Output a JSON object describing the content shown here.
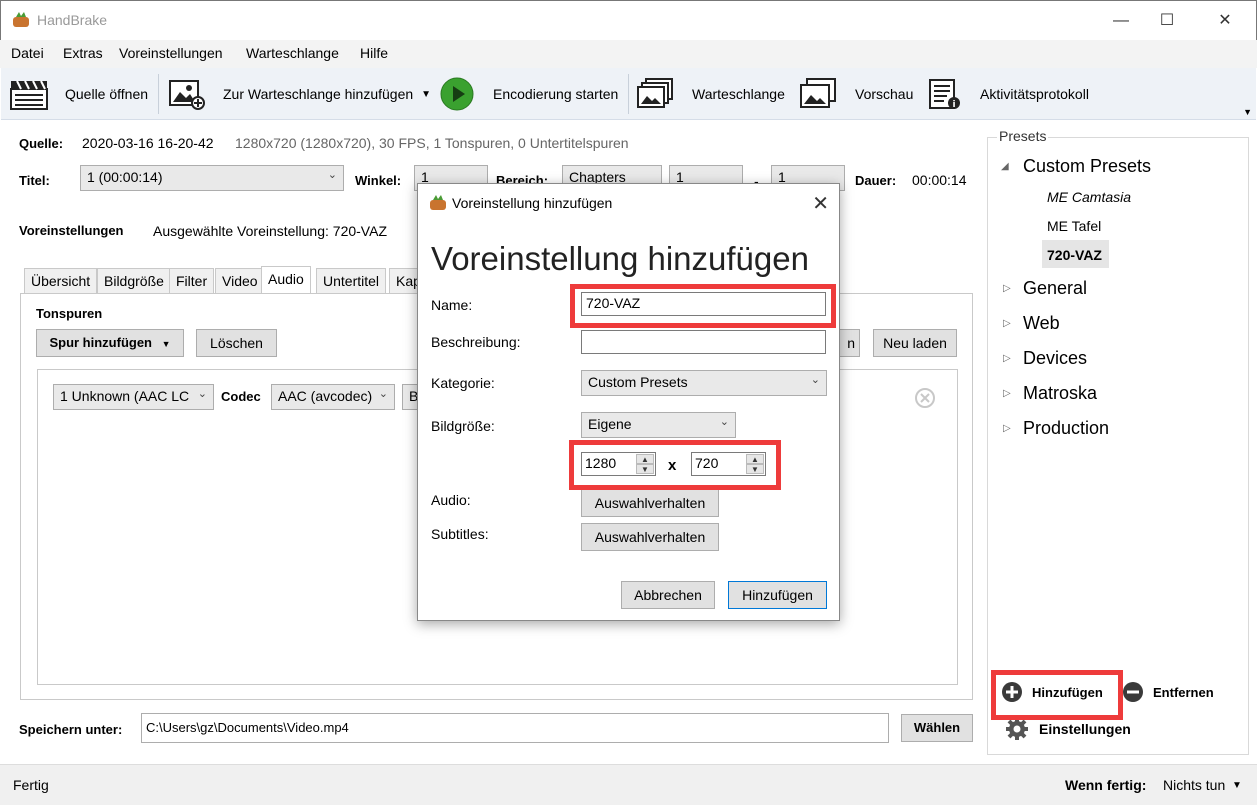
{
  "window": {
    "title": "HandBrake"
  },
  "menu": [
    "Datei",
    "Extras",
    "Voreinstellungen",
    "Warteschlange",
    "Hilfe"
  ],
  "toolbar": {
    "open_source": "Quelle öffnen",
    "add_queue": "Zur Warteschlange hinzufügen",
    "start_encode": "Encodierung starten",
    "queue": "Warteschlange",
    "preview": "Vorschau",
    "activity_log": "Aktivitätsprotokoll"
  },
  "source": {
    "label": "Quelle:",
    "name": "2020-03-16 16-20-42",
    "info": "1280x720 (1280x720), 30 FPS, 1 Tonspuren, 0 Untertitelspuren"
  },
  "title_row": {
    "title_label": "Titel:",
    "title_value": "1 (00:00:14)",
    "angle_label": "Winkel:",
    "angle_value": "1",
    "range_label": "Bereich:",
    "range_type": "Chapters",
    "range_from": "1",
    "range_sep": "-",
    "range_to": "1",
    "duration_label": "Dauer:",
    "duration_value": "00:00:14"
  },
  "preset_row": {
    "label": "Voreinstellungen",
    "selected": "Ausgewählte Voreinstellung: 720-VAZ"
  },
  "tabs": [
    "Übersicht",
    "Bildgröße",
    "Filter",
    "Video",
    "Audio",
    "Untertitel",
    "Kap"
  ],
  "audio": {
    "heading": "Tonspuren",
    "add_track": "Spur hinzufügen",
    "delete": "Löschen",
    "partial_button": "n",
    "reload": "Neu laden",
    "track_value": "1 Unknown (AAC LC",
    "codec_label": "Codec",
    "codec_value": "AAC (avcodec)",
    "partial_combo": "B"
  },
  "save": {
    "label": "Speichern unter:",
    "path": "C:\\Users\\gz\\Documents\\Video.mp4",
    "choose": "Wählen"
  },
  "presets_panel": {
    "legend": "Presets",
    "groups": [
      {
        "name": "Custom Presets",
        "expanded": true,
        "children": [
          "ME Camtasia",
          "ME Tafel",
          "720-VAZ"
        ]
      },
      {
        "name": "General"
      },
      {
        "name": "Web"
      },
      {
        "name": "Devices"
      },
      {
        "name": "Matroska"
      },
      {
        "name": "Production"
      }
    ],
    "add": "Hinzufügen",
    "remove": "Entfernen",
    "settings": "Einstellungen"
  },
  "status": {
    "left": "Fertig",
    "when_done_label": "Wenn fertig:",
    "when_done_value": "Nichts tun"
  },
  "dialog": {
    "window_title": "Voreinstellung hinzufügen",
    "heading": "Voreinstellung hinzufügen",
    "name_label": "Name:",
    "name_value": "720-VAZ",
    "description_label": "Beschreibung:",
    "description_value": "",
    "category_label": "Kategorie:",
    "category_value": "Custom Presets",
    "picture_label": "Bildgröße:",
    "picture_value": "Eigene",
    "width": "1280",
    "by": "x",
    "height": "720",
    "audio_label": "Audio:",
    "audio_button": "Auswahlverhalten",
    "subtitles_label": "Subtitles:",
    "subtitles_button": "Auswahlverhalten",
    "cancel": "Abbrechen",
    "add": "Hinzufügen"
  },
  "colors": {
    "highlight": "#ee3b3b",
    "play_green": "#3aa12f",
    "accent": "#0078d7"
  }
}
